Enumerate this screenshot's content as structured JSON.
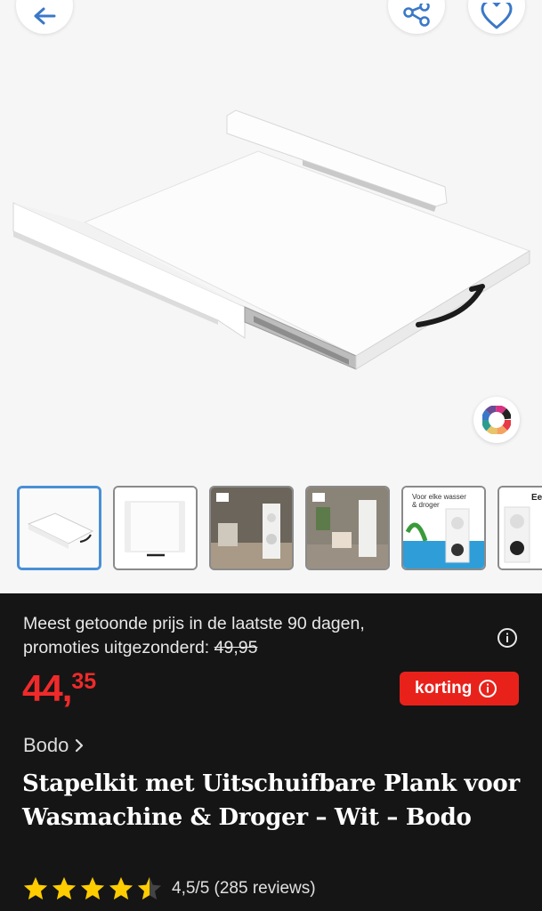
{
  "gallery": {
    "thumbnails": [
      {
        "name": "thumb-product-front",
        "active": true
      },
      {
        "name": "thumb-product-top",
        "active": false
      },
      {
        "name": "thumb-lifestyle-laundry-room-1",
        "active": false
      },
      {
        "name": "thumb-lifestyle-laundry-room-2",
        "active": false
      },
      {
        "name": "thumb-infographic-every-washer",
        "active": false,
        "text": "Voor elke wasser & droger"
      },
      {
        "name": "thumb-infographic-partial",
        "active": false,
        "text": "Een"
      }
    ]
  },
  "price_info": {
    "note_line1": "Meest getoonde prijs in de laatste 90 dagen,",
    "note_line2_prefix": "promoties uitgezonderd: ",
    "old_price": "49,95",
    "price_main": "44,",
    "price_cents": "35",
    "korting_label": "korting"
  },
  "product": {
    "brand": "Bodo",
    "title": "Stapelkit met Uitschuifbare Plank voor Wasmachine & Droger – Wit – Bodo",
    "rating_text": "4,5/5 (285 reviews)",
    "rating_value": 4.5
  },
  "colors": {
    "price": "#f02a2a",
    "korting_bg": "#e8221b",
    "active_thumb": "#4a8fd6",
    "info_bg": "#151515"
  },
  "icons": [
    "back-arrow-icon",
    "share-icon",
    "heart-icon",
    "color-wheel-icon",
    "info-icon",
    "chevron-right-icon",
    "star-icon"
  ]
}
